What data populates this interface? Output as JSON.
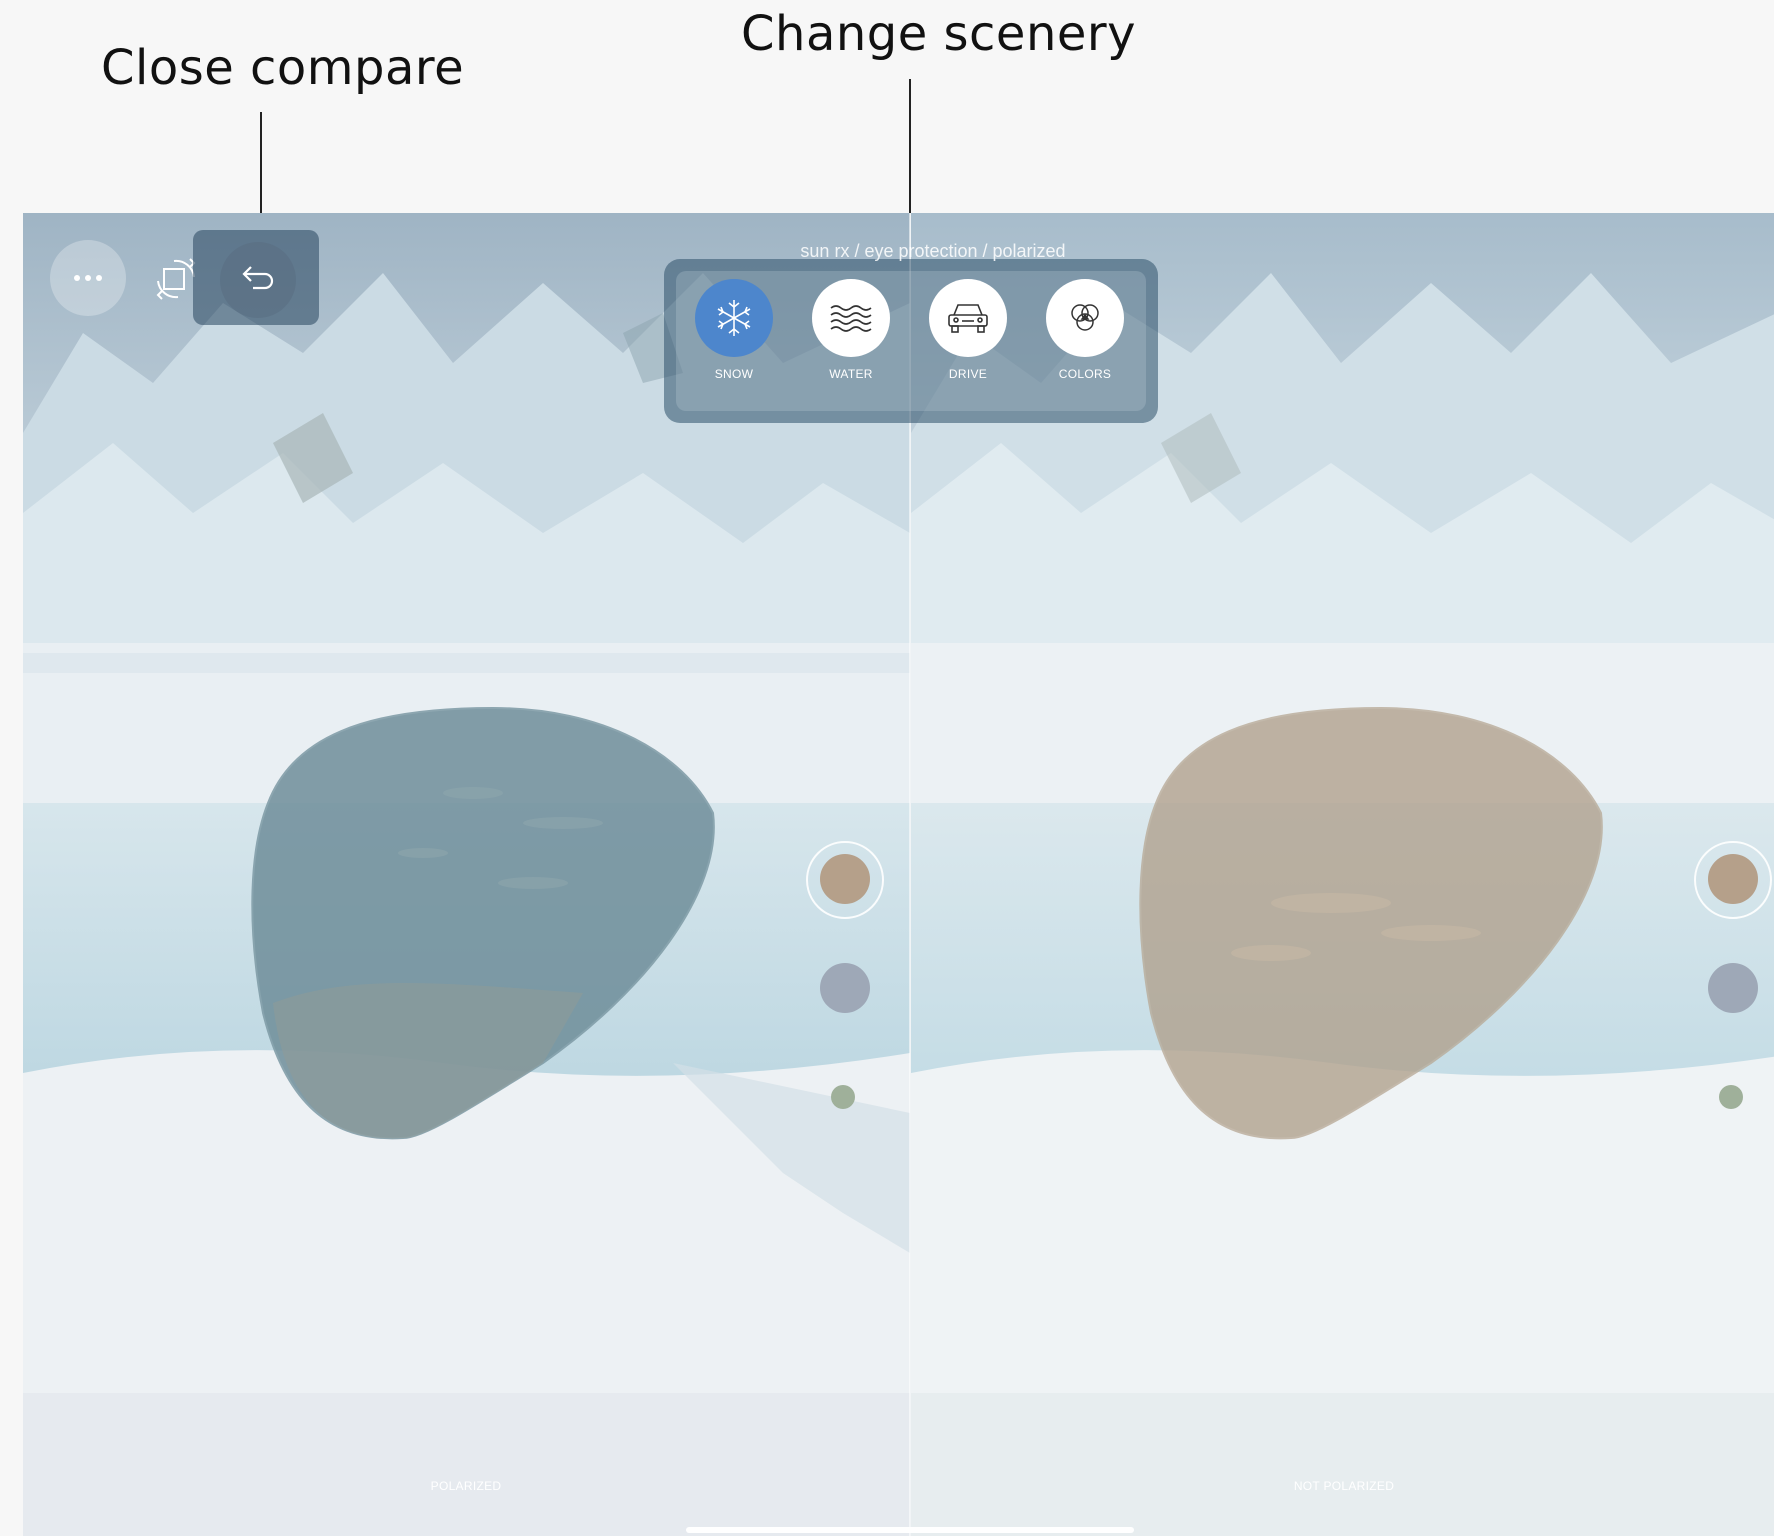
{
  "annotations": {
    "close_compare": "Close compare",
    "change_scenery": "Change scenery"
  },
  "top_bar": {
    "menu_icon": "ellipsis-icon",
    "rotate_icon": "rotate-icon",
    "back_icon": "back-arrow-icon"
  },
  "breadcrumb": "sun rx / eye protection / polarized",
  "scenery": {
    "options": [
      {
        "label": "SNOW",
        "icon": "snowflake-icon",
        "active": true
      },
      {
        "label": "WATER",
        "icon": "waves-icon",
        "active": false
      },
      {
        "label": "DRIVE",
        "icon": "car-icon",
        "active": false
      },
      {
        "label": "COLORS",
        "icon": "color-circles-icon",
        "active": false
      }
    ]
  },
  "panes": {
    "left": {
      "label": "POLARIZED",
      "lens_tint": "#6f8e9a"
    },
    "right": {
      "label": "NOT POLARIZED",
      "lens_tint": "#b0a08c"
    }
  },
  "swatches": [
    {
      "color": "#b5a08a",
      "selected": true
    },
    {
      "color": "#9ea8b7",
      "selected": false
    },
    {
      "color": "#9fb09a",
      "selected": false
    }
  ],
  "colors": {
    "active_scene": "#4d86cc",
    "snow": "#f2f5f7",
    "ice": "#bcd6e2"
  }
}
